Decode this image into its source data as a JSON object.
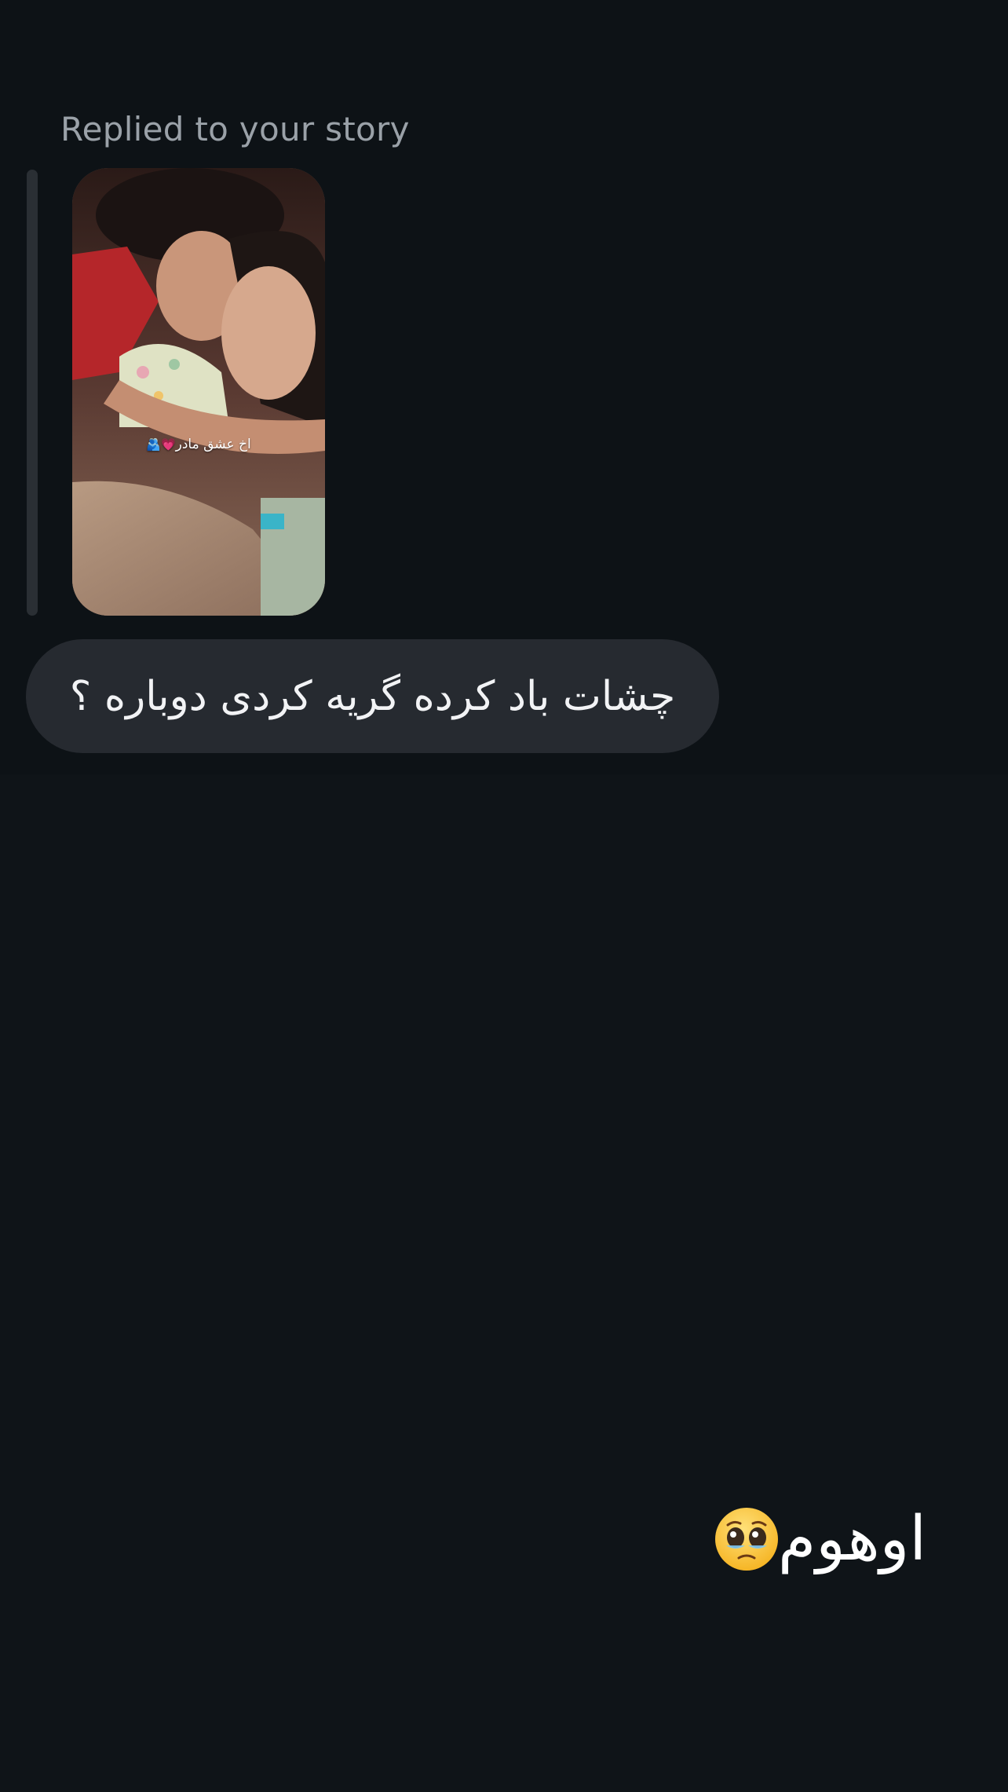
{
  "story_reply": {
    "label": "Replied to your story",
    "story_caption": "اخ عشق مادر",
    "story_caption_emoji": "💗🫂"
  },
  "messages": [
    {
      "side": "received",
      "text": "چشات باد کرده گریه کردی دوباره ؟"
    },
    {
      "side": "sent",
      "text": "اوهوم",
      "emoji": "pleading-face-with-tears-icon"
    }
  ],
  "colors": {
    "background": "#0f1418",
    "bubble_received": "#262a30",
    "label": "#9aa1a8"
  }
}
